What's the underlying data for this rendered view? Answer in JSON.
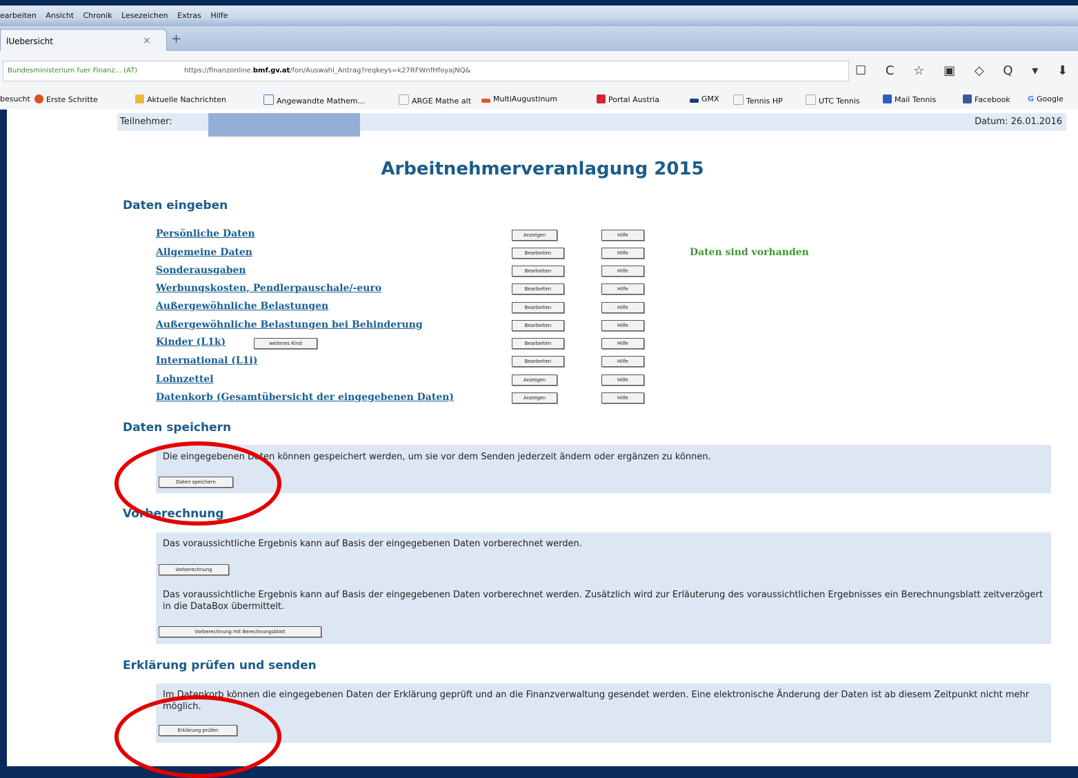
{
  "browser": {
    "menu": [
      "earbeiten",
      "Ansicht",
      "Chronik",
      "Lesezeichen",
      "Extras",
      "Hilfe"
    ],
    "tab_title": "lUebersicht",
    "tab_close": "×",
    "new_tab": "+",
    "site_org": "Bundesministerium fuer Finanz... (AT)",
    "url_prefix": "https://finanzonline.",
    "url_domain": "bmf.gv.at",
    "url_rest": "/fon/Auswahl_Antrag?reqkeys=k27RFWnfHfoyajNQ&",
    "nav_icons": [
      "☐",
      "C",
      "☆",
      "▣",
      "◇",
      "Q",
      "▾",
      "⬇",
      "⌂",
      "◂"
    ],
    "bookmarks": [
      {
        "label": "besucht",
        "color": "transparent"
      },
      {
        "label": "Erste Schritte",
        "color": "#d9531e"
      },
      {
        "label": "Aktuelle Nachrichten",
        "color": "#f0b83a"
      },
      {
        "label": "Angewandte Mathem...",
        "color": "#3a7bd5"
      },
      {
        "label": "ARGE Mathe alt",
        "color": "#ffffff"
      },
      {
        "label": "MultiAugustinum",
        "color": "#e0562d"
      },
      {
        "label": "Portal Austria",
        "color": "#d6252c"
      },
      {
        "label": "GMX",
        "color": "#1b3f7a"
      },
      {
        "label": "Tennis HP",
        "color": "#ffffff"
      },
      {
        "label": "UTC Tennis",
        "color": "#ffffff"
      },
      {
        "label": "Mail Tennis",
        "color": "#2f5fbf"
      },
      {
        "label": "Facebook",
        "color": "#3b5998"
      },
      {
        "label": "Google",
        "color": "transparent"
      }
    ]
  },
  "page": {
    "participant_label": "Teilnehmer:",
    "date": "Datum: 26.01.2016",
    "title": "Arbeitnehmerveranlagung 2015",
    "data_heading": "Daten eingeben",
    "rows": [
      {
        "label": "Persönliche Daten",
        "action": "Anzeigen",
        "help": "Hilfe"
      },
      {
        "label": "Allgemeine Daten",
        "action": "Bearbeiten",
        "help": "Hilfe"
      },
      {
        "label": "Sonderausgaben",
        "action": "Bearbeiten",
        "help": "Hilfe"
      },
      {
        "label": "Werbungskosten, Pendlerpauschale/-euro",
        "action": "Bearbeiten",
        "help": "Hilfe"
      },
      {
        "label": "Außergewöhnliche Belastungen",
        "action": "Bearbeiten",
        "help": "Hilfe"
      },
      {
        "label": "Außergewöhnliche Belastungen bei Behinderung",
        "action": "Bearbeiten",
        "help": "Hilfe"
      },
      {
        "label": "Kinder (L1k)",
        "action": "Bearbeiten",
        "help": "Hilfe"
      },
      {
        "label": "International (L1i)",
        "action": "Bearbeiten",
        "help": "Hilfe"
      },
      {
        "label": "Lohnzettel",
        "action": "Anzeigen",
        "help": "Hilfe"
      },
      {
        "label": "Datenkorb (Gesamtübersicht der eingegebenen Daten)",
        "action": "Anzeigen",
        "help": "Hilfe"
      }
    ],
    "extra_child_button": "weiteres Kind",
    "status_text": "Daten sind vorhanden",
    "save_heading": "Daten speichern",
    "save_text": "Die eingegebenen Daten können gespeichert werden, um sie vor dem Senden jederzeit ändern oder ergänzen zu können.",
    "save_button": "Daten speichern",
    "precalc_heading": "Vorberechnung",
    "precalc_text1": "Das voraussichtliche Ergebnis kann auf Basis der eingegebenen Daten vorberechnet werden.",
    "precalc_button1": "Vorberechnung",
    "precalc_text2": "Das voraussichtliche Ergebnis kann auf Basis der eingegebenen Daten vorberechnet werden. Zusätzlich wird zur Erläuterung des voraussichtlichen Ergebnisses ein Berechnungsblatt zeitverzögert in die DataBox übermittelt.",
    "precalc_button2": "Vorberechnung mit Berechnungsblatt",
    "check_heading": "Erklärung prüfen und senden",
    "check_text": "Im Datenkorb können die eingegebenen Daten der Erklärung geprüft und an die Finanzverwaltung gesendet werden. Eine elektronische Änderung der Daten ist ab diesem Zeitpunkt nicht mehr möglich.",
    "check_button": "Erklärung prüfen"
  },
  "colors": {
    "heading": "#1b5c89",
    "link": "#1a6093",
    "status": "#3c9a2e",
    "annotation": "#e40000"
  }
}
